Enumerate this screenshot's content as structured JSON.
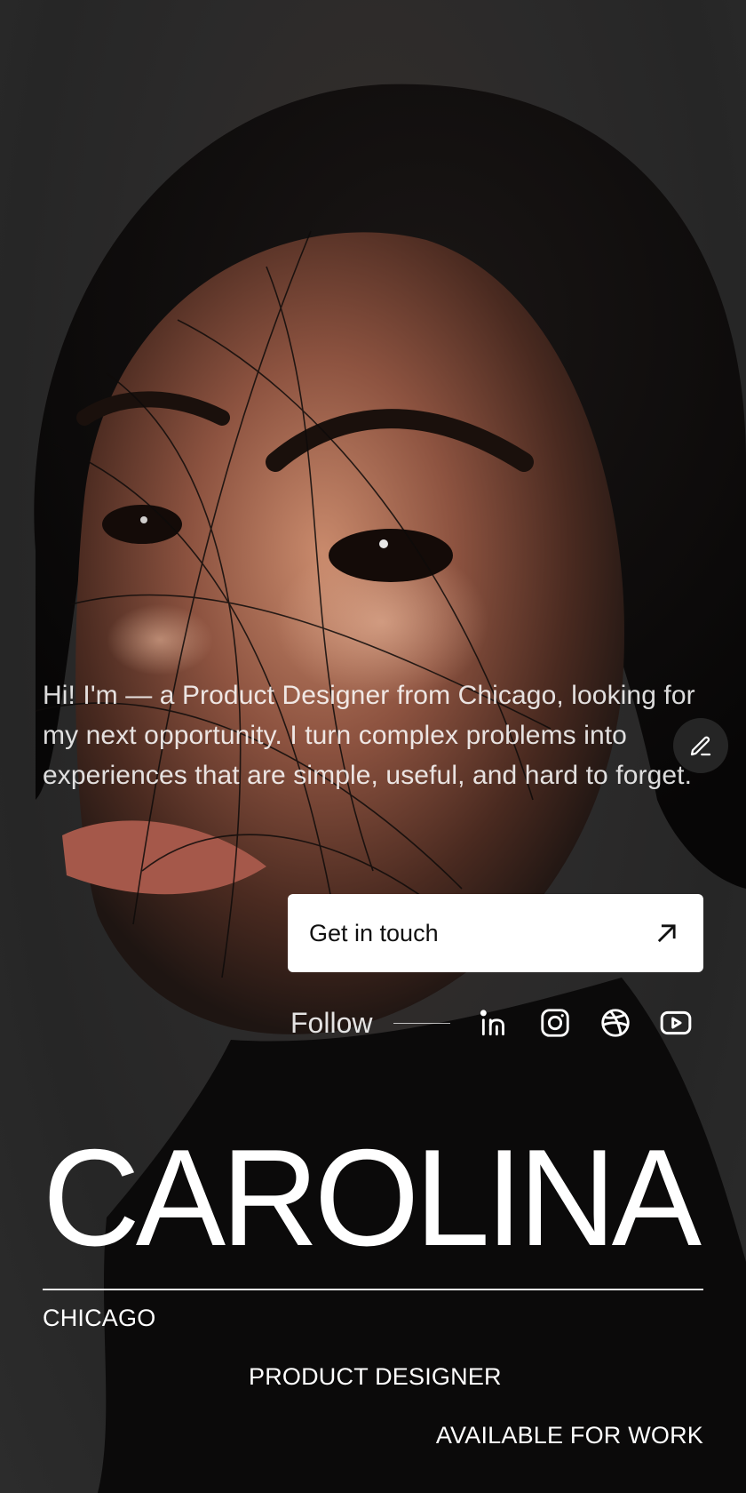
{
  "intro": {
    "text": "Hi! I'm  — a Product Designer from Chicago, looking for my next opportunity. I turn complex problems into  experiences that are simple, useful, and hard to forget."
  },
  "cta": {
    "label": "Get in touch",
    "icon": "arrow-up-right-icon"
  },
  "edit": {
    "icon": "pencil-icon"
  },
  "follow": {
    "label": "Follow",
    "socials": [
      {
        "icon": "linkedin-icon"
      },
      {
        "icon": "instagram-icon"
      },
      {
        "icon": "dribbble-icon"
      },
      {
        "icon": "youtube-icon"
      }
    ]
  },
  "hero": {
    "name": "CAROLINA",
    "city": "CHICAGO",
    "role": "PRODUCT DESIGNER",
    "status": "AVAILABLE FOR WORK"
  },
  "colors": {
    "background": "#2b2b2b",
    "text": "#ffffff",
    "button": "#ffffff",
    "button_text": "#111111"
  }
}
